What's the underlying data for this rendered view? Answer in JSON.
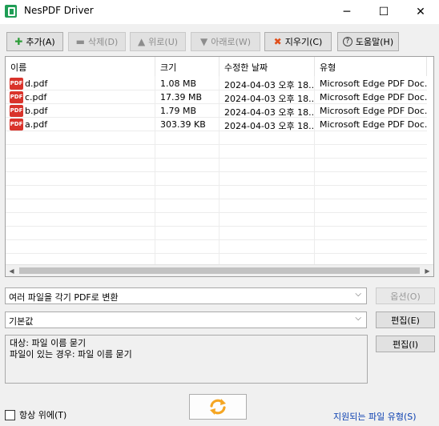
{
  "window": {
    "title": "NesPDF Driver",
    "minimize": "─",
    "maximize": "☐",
    "close": "✕"
  },
  "toolbar": {
    "add": "추가(A)",
    "delete": "삭제(D)",
    "up": "위로(U)",
    "down": "아래로(W)",
    "clear": "지우기(C)",
    "help": "도움말(H)"
  },
  "list": {
    "columns": [
      "이름",
      "크기",
      "수정한 날짜",
      "유형"
    ],
    "rows": [
      {
        "name": "d.pdf",
        "size": "1.08 MB",
        "modified": "2024-04-03 오후 18...",
        "type": "Microsoft Edge PDF Doc..."
      },
      {
        "name": "c.pdf",
        "size": "17.39 MB",
        "modified": "2024-04-03 오후 18...",
        "type": "Microsoft Edge PDF Doc..."
      },
      {
        "name": "b.pdf",
        "size": "1.79 MB",
        "modified": "2024-04-03 오후 18...",
        "type": "Microsoft Edge PDF Doc..."
      },
      {
        "name": "a.pdf",
        "size": "303.39 KB",
        "modified": "2024-04-03 오후 18...",
        "type": "Microsoft Edge PDF Doc..."
      }
    ],
    "file_icon_text": "PDF"
  },
  "mode_select": {
    "value": "여러 파일을 각기 PDF로 변환",
    "options_button": "옵션(O)"
  },
  "profile_select": {
    "value": "기본값",
    "edit_button": "편집(E)"
  },
  "info": {
    "line1": "대상: 파일 이름 묻기",
    "line2": "파일이 있는 경우: 파일 이름 묻기",
    "edit_button": "편집(I)"
  },
  "footer": {
    "always_on_top": "항상 위에(T)",
    "supported_types_link": "지원되는 파일 유형(S)"
  },
  "colors": {
    "accent_orange": "#f5a623",
    "pdf_red": "#d9332b",
    "link_blue": "#0a3fb0"
  }
}
